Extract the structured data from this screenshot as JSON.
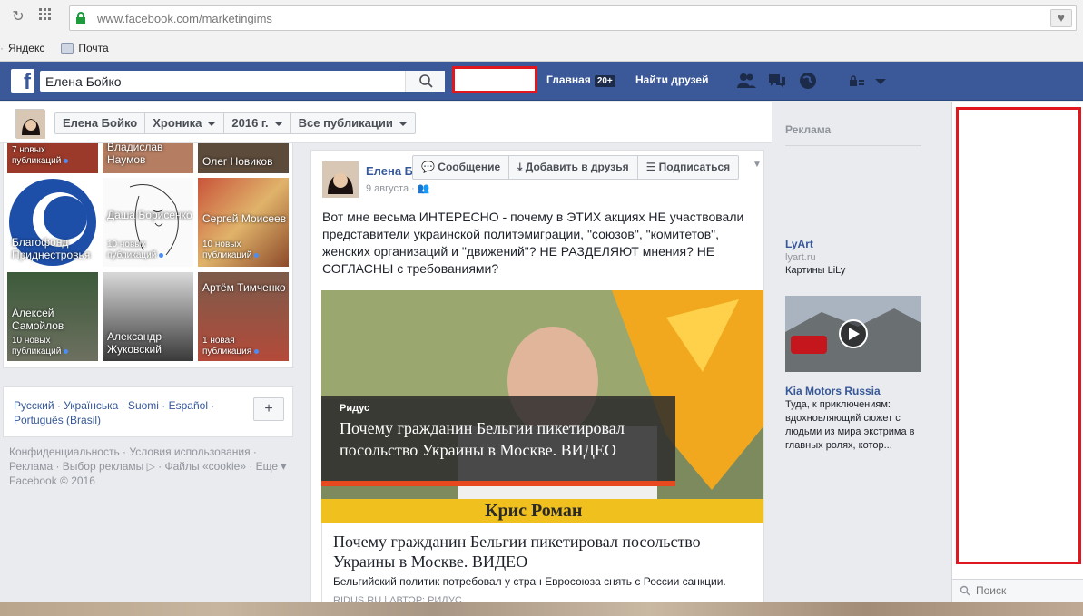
{
  "browser": {
    "url": "www.facebook.com/marketingims",
    "bookmarks": [
      "Яндекс",
      "Почта"
    ]
  },
  "fb": {
    "search_value": "Елена Бойко",
    "nav_home": "Главная",
    "nav_home_badge": "20+",
    "nav_find_friends": "Найти друзей"
  },
  "profile_nav": {
    "name": "Елена Бойко",
    "items": [
      "Хроника",
      "2016 г.",
      "Все публикации"
    ]
  },
  "friends": [
    {
      "name": "",
      "sub1": "7 новых",
      "sub2": "публикаций"
    },
    {
      "name": "Владислав Наумов",
      "sub1": "",
      "sub2": ""
    },
    {
      "name": "Олег Новиков",
      "sub1": "",
      "sub2": ""
    },
    {
      "name": "Благофонд Приднестровья",
      "sub1": "",
      "sub2": ""
    },
    {
      "name": "Даша Борисенко",
      "sub1": "10 новых",
      "sub2": "публикаций"
    },
    {
      "name": "Сергей Моисеев",
      "sub1": "10 новых",
      "sub2": "публикаций"
    },
    {
      "name": "Алексей Самойлов",
      "sub1": "10 новых",
      "sub2": "публикаций"
    },
    {
      "name": "Александр Жуковский",
      "sub1": "",
      "sub2": ""
    },
    {
      "name": "Артём Тимченко",
      "sub1": "1 новая",
      "sub2": "публикация"
    }
  ],
  "languages": "Русский · Українська · Suomi · Español · Português (Brasil)",
  "footer": {
    "line1": "Конфиденциальность · Условия использования ·",
    "line2": "Реклама · Выбор рекламы ▷ · Файлы «cookie» · Еще ▾",
    "line3": "Facebook © 2016"
  },
  "post": {
    "author": "Елена Б",
    "date": "9 августа ·",
    "hover_buttons": [
      "Сообщение",
      "Добавить в друзья",
      "Подписаться"
    ],
    "text": "Вот мне весьма ИНТЕРЕСНО - почему в ЭТИХ акциях НЕ участвовали представители украинской политэмиграции, \"союзов\", \"комитетов\", женских организаций и \"движений\"? НЕ РАЗДЕЛЯЮТ мнения? НЕ СОГЛАСНЫ с требованиями?",
    "media_brand": "Ридус",
    "media_headline": "Почему гражданин Бельгии пикетировал посольство Украины в Москве. ВИДЕО",
    "media_caption": "Крис Роман",
    "link_title": "Почему гражданин Бельгии пикетировал посольство Украины в Москве. ВИДЕО",
    "link_desc": "Бельгийский политик потребовал у стран Евросоюза снять с России санкции.",
    "link_source": "RIDUS.RU | АВТОР: РИДУС"
  },
  "ads": {
    "header": "Реклама",
    "ad1_title": "LyArt",
    "ad1_url": "lyart.ru",
    "ad1_body": "Картины LiLy",
    "ad2_title": "Kia Motors Russia",
    "ad2_body": "Туда, к приключениям: вдохновляющий сюжет с людьми из мира экстрима в главных ролях, котор..."
  },
  "chat": {
    "search_placeholder": "Поиск"
  }
}
